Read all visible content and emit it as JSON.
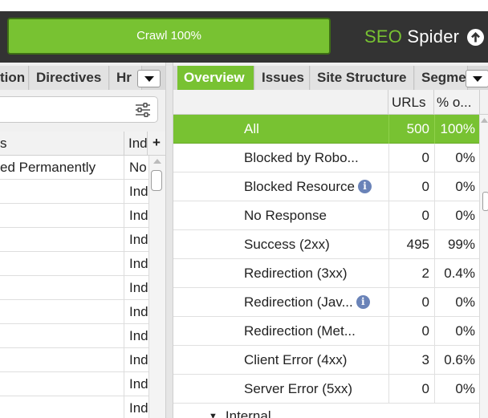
{
  "toolbar": {
    "progress_label": "Crawl 100%",
    "progress_fraction": 1.0,
    "brand_seo": "SEO",
    "brand_spider": "Spider",
    "upload_icon": "arrow-up-circle-icon"
  },
  "left_tabs": [
    "tion",
    "Directives",
    "Hr"
  ],
  "left_search": {
    "value": "",
    "placeholder": ""
  },
  "left_table": {
    "columns": [
      "s",
      "Ind"
    ],
    "rows": [
      {
        "status": "ed Permanently",
        "indexability": "No"
      },
      {
        "status": "",
        "indexability": "Ind"
      },
      {
        "status": "",
        "indexability": "Ind"
      },
      {
        "status": "",
        "indexability": "Ind"
      },
      {
        "status": "",
        "indexability": "Ind"
      },
      {
        "status": "",
        "indexability": "Ind"
      },
      {
        "status": "",
        "indexability": "Ind"
      },
      {
        "status": "",
        "indexability": "Ind"
      },
      {
        "status": "",
        "indexability": "Ind"
      },
      {
        "status": "",
        "indexability": "Ind"
      },
      {
        "status": "",
        "indexability": "Ind"
      }
    ]
  },
  "right_tabs": [
    "Overview",
    "Issues",
    "Site Structure",
    "Segme"
  ],
  "overview": {
    "columns": {
      "urls": "URLs",
      "percent": "% o..."
    },
    "rows": [
      {
        "label": "All",
        "urls": "500",
        "percent": "100%",
        "info": false
      },
      {
        "label": "Blocked by Robo...",
        "urls": "0",
        "percent": "0%",
        "info": false
      },
      {
        "label": "Blocked Resource",
        "urls": "0",
        "percent": "0%",
        "info": true
      },
      {
        "label": "No Response",
        "urls": "0",
        "percent": "0%",
        "info": false
      },
      {
        "label": "Success (2xx)",
        "urls": "495",
        "percent": "99%",
        "info": false
      },
      {
        "label": "Redirection (3xx)",
        "urls": "2",
        "percent": "0.4%",
        "info": false
      },
      {
        "label": "Redirection (Jav...",
        "urls": "0",
        "percent": "0%",
        "info": true
      },
      {
        "label": "Redirection (Met...",
        "urls": "0",
        "percent": "0%",
        "info": false
      },
      {
        "label": "Client Error (4xx)",
        "urls": "3",
        "percent": "0.6%",
        "info": false
      },
      {
        "label": "Server Error (5xx)",
        "urls": "0",
        "percent": "0%",
        "info": false
      }
    ],
    "group_label": "Internal"
  },
  "colors": {
    "accent_green": "#78c232",
    "toolbar_bg": "#333333",
    "info_icon": "#6a83b8"
  }
}
